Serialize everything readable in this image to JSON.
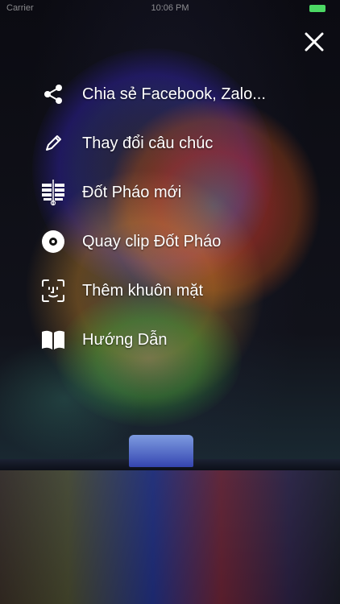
{
  "status_bar": {
    "carrier": "Carrier",
    "time": "10:06 PM",
    "battery_color": "#4cd964"
  },
  "header": {
    "close_icon": "close-icon"
  },
  "menu": {
    "items": [
      {
        "label": "Chia sẻ Facebook, Zalo...",
        "icon": "share-icon"
      },
      {
        "label": "Thay đổi câu chúc",
        "icon": "pencil-icon"
      },
      {
        "label": "Đốt Pháo mới",
        "icon": "firecracker-icon"
      },
      {
        "label": "Quay clip Đốt Pháo",
        "icon": "disc-icon"
      },
      {
        "label": "Thêm khuôn mặt",
        "icon": "face-scan-icon"
      },
      {
        "label": "Hướng Dẫn",
        "icon": "book-icon"
      }
    ]
  },
  "background": {
    "image": "fireworks over water"
  }
}
